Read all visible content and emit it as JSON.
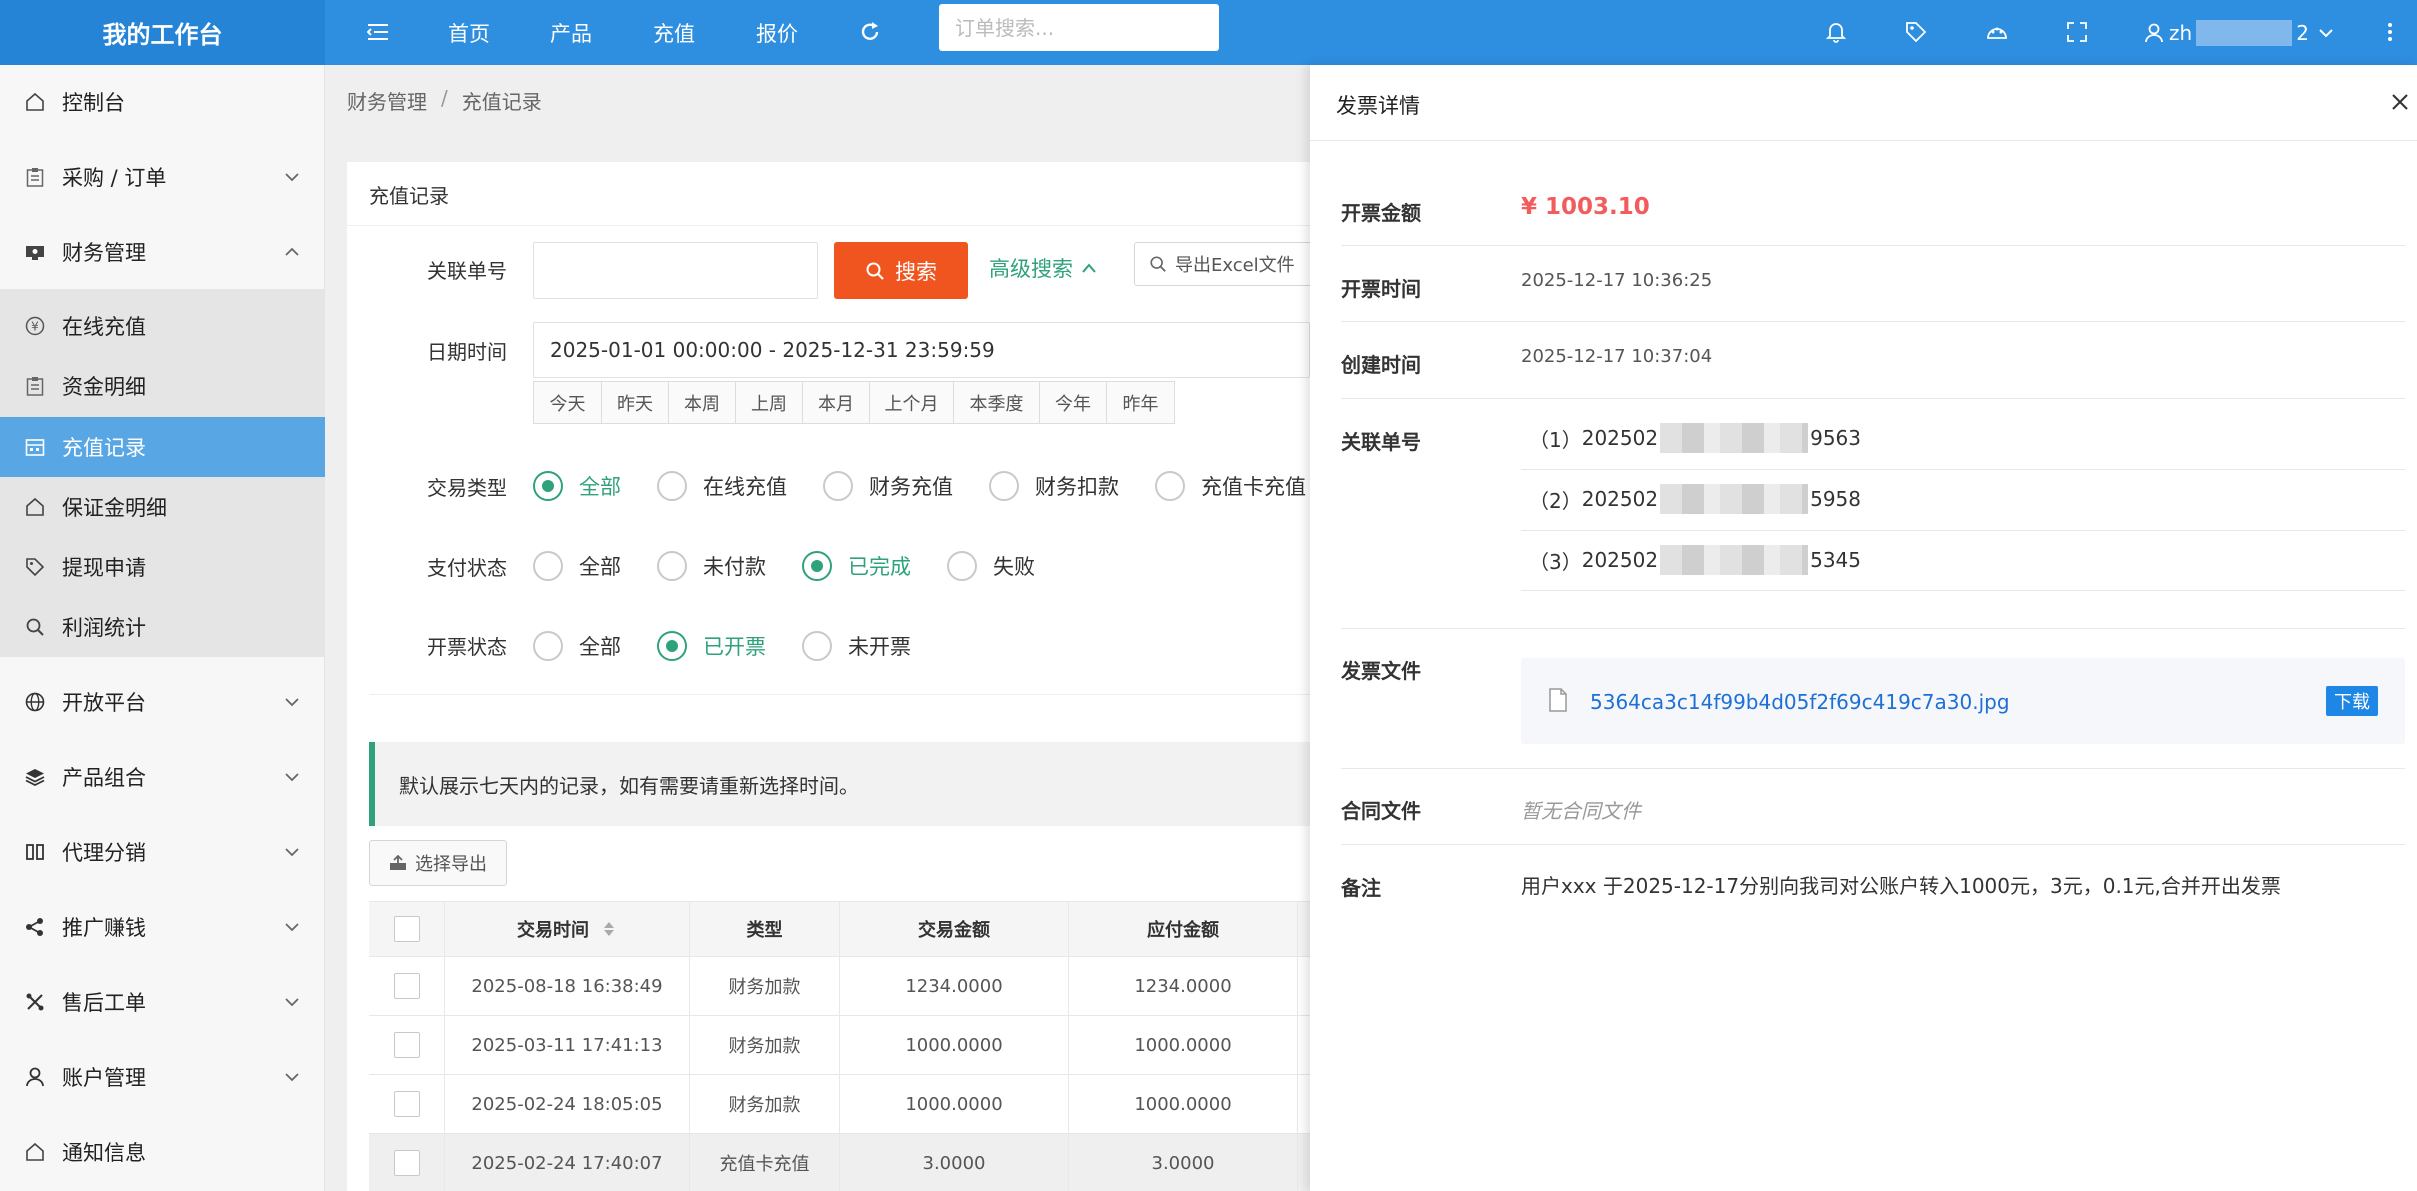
{
  "header": {
    "logo": "我的工作台",
    "nav": [
      "首页",
      "产品",
      "充值",
      "报价"
    ],
    "search_placeholder": "订单搜索...",
    "user_prefix": "zh",
    "user_suffix": "2"
  },
  "sidebar": {
    "items": [
      {
        "label": "控制台",
        "icon": "home-icon"
      },
      {
        "label": "采购 / 订单",
        "icon": "clipboard-icon"
      },
      {
        "label": "财务管理",
        "icon": "finance-icon"
      },
      {
        "label": "在线充值",
        "icon": "yen-icon"
      },
      {
        "label": "资金明细",
        "icon": "clipboard-icon"
      },
      {
        "label": "充值记录",
        "icon": "calendar-icon"
      },
      {
        "label": "保证金明细",
        "icon": "home-icon"
      },
      {
        "label": "提现申请",
        "icon": "tag-icon"
      },
      {
        "label": "利润统计",
        "icon": "search-icon"
      },
      {
        "label": "开放平台",
        "icon": "globe-icon"
      },
      {
        "label": "产品组合",
        "icon": "layers-icon"
      },
      {
        "label": "代理分销",
        "icon": "columns-icon"
      },
      {
        "label": "推广赚钱",
        "icon": "share-icon"
      },
      {
        "label": "售后工单",
        "icon": "tools-icon"
      },
      {
        "label": "账户管理",
        "icon": "user-icon"
      },
      {
        "label": "通知信息",
        "icon": "home-icon"
      }
    ]
  },
  "breadcrumb": [
    "财务管理",
    "/",
    "充值记录"
  ],
  "panel_title": "充值记录",
  "form": {
    "order_label": "关联单号",
    "search_btn": "搜索",
    "adv_search": "高级搜索",
    "export_excel": "导出Excel文件",
    "date_label": "日期时间",
    "date_range": "2025-01-01 00:00:00 - 2025-12-31 23:59:59",
    "quick_dates": [
      "今天",
      "昨天",
      "本周",
      "上周",
      "本月",
      "上个月",
      "本季度",
      "今年",
      "昨年"
    ],
    "trade_type_label": "交易类型",
    "trade_types": [
      "全部",
      "在线充值",
      "财务充值",
      "财务扣款",
      "充值卡充值"
    ],
    "pay_status_label": "支付状态",
    "pay_status": [
      "全部",
      "未付款",
      "已完成",
      "失败"
    ],
    "invoice_status_label": "开票状态",
    "invoice_status": [
      "全部",
      "已开票",
      "未开票"
    ]
  },
  "notice": "默认展示七天内的记录，如有需要请重新选择时间。",
  "select_export": "选择导出",
  "table": {
    "headers": [
      "交易时间",
      "类型",
      "交易金额",
      "应付金额"
    ],
    "rows": [
      [
        "2025-08-18 16:38:49",
        "财务加款",
        "1234.0000",
        "1234.0000"
      ],
      [
        "2025-03-11 17:41:13",
        "财务加款",
        "1000.0000",
        "1000.0000"
      ],
      [
        "2025-02-24 18:05:05",
        "财务加款",
        "1000.0000",
        "1000.0000"
      ],
      [
        "2025-02-24 17:40:07",
        "充值卡充值",
        "3.0000",
        "3.0000"
      ]
    ]
  },
  "drawer": {
    "title": "发票详情",
    "amount_label": "开票金额",
    "amount": "¥ 1003.10",
    "invoice_time_label": "开票时间",
    "invoice_time": "2025-12-17 10:36:25",
    "created_label": "创建时间",
    "created_time": "2025-12-17 10:37:04",
    "orders_label": "关联单号",
    "orders": [
      {
        "index": "（1）",
        "prefix": "202502",
        "suffix": "9563"
      },
      {
        "index": "（2）",
        "prefix": "202502",
        "suffix": "5958"
      },
      {
        "index": "（3）",
        "prefix": "202502",
        "suffix": "5345"
      }
    ],
    "file_label": "发票文件",
    "file_name": "5364ca3c14f99b4d05f2f69c419c7a30.jpg",
    "download": "下载",
    "contract_label": "合同文件",
    "contract_empty": "暂无合同文件",
    "remark_label": "备注",
    "remark": "用户xxx 于2025-12-17分别向我司对公账户转入1000元，3元，0.1元,合并开出发票"
  }
}
